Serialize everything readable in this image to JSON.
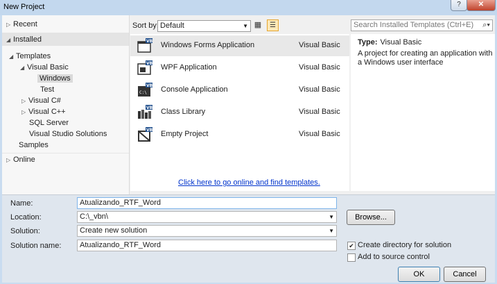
{
  "window": {
    "title": "New Project",
    "help_label": "?",
    "close_label": "✕"
  },
  "tree": {
    "recent": "Recent",
    "installed": "Installed",
    "templates": "Templates",
    "visual_basic": "Visual Basic",
    "windows": "Windows",
    "test": "Test",
    "visual_csharp": "Visual C#",
    "visual_cpp": "Visual C++",
    "sql_server": "SQL Server",
    "vs_solutions": "Visual Studio Solutions",
    "samples": "Samples",
    "online": "Online"
  },
  "toolbar": {
    "sort_label": "Sort by:",
    "sort_value": "Default",
    "search_placeholder": "Search Installed Templates (Ctrl+E)"
  },
  "templates": [
    {
      "name": "Windows Forms Application",
      "lang": "Visual Basic",
      "icon": "windows-forms-icon"
    },
    {
      "name": "WPF Application",
      "lang": "Visual Basic",
      "icon": "wpf-icon"
    },
    {
      "name": "Console Application",
      "lang": "Visual Basic",
      "icon": "console-icon"
    },
    {
      "name": "Class Library",
      "lang": "Visual Basic",
      "icon": "class-library-icon"
    },
    {
      "name": "Empty Project",
      "lang": "Visual Basic",
      "icon": "empty-project-icon"
    }
  ],
  "online_link": "Click here to go online and find templates.",
  "details": {
    "type_label": "Type:",
    "type_value": "Visual Basic",
    "description": "A project for creating an application with a Windows user interface"
  },
  "form": {
    "name_label": "Name:",
    "name_value": "Atualizando_RTF_Word",
    "location_label": "Location:",
    "location_value": "C:\\_vbn\\",
    "solution_label": "Solution:",
    "solution_value": "Create new solution",
    "solution_name_label": "Solution name:",
    "solution_name_value": "Atualizando_RTF_Word",
    "browse_label": "Browse...",
    "create_dir_label": "Create directory for solution",
    "create_dir_checked": true,
    "source_control_label": "Add to source control",
    "source_control_checked": false,
    "ok_label": "OK",
    "cancel_label": "Cancel"
  },
  "colors": {
    "accent": "#3c7fb1",
    "link": "#0033cc",
    "chrome": "#c9dcf0"
  }
}
